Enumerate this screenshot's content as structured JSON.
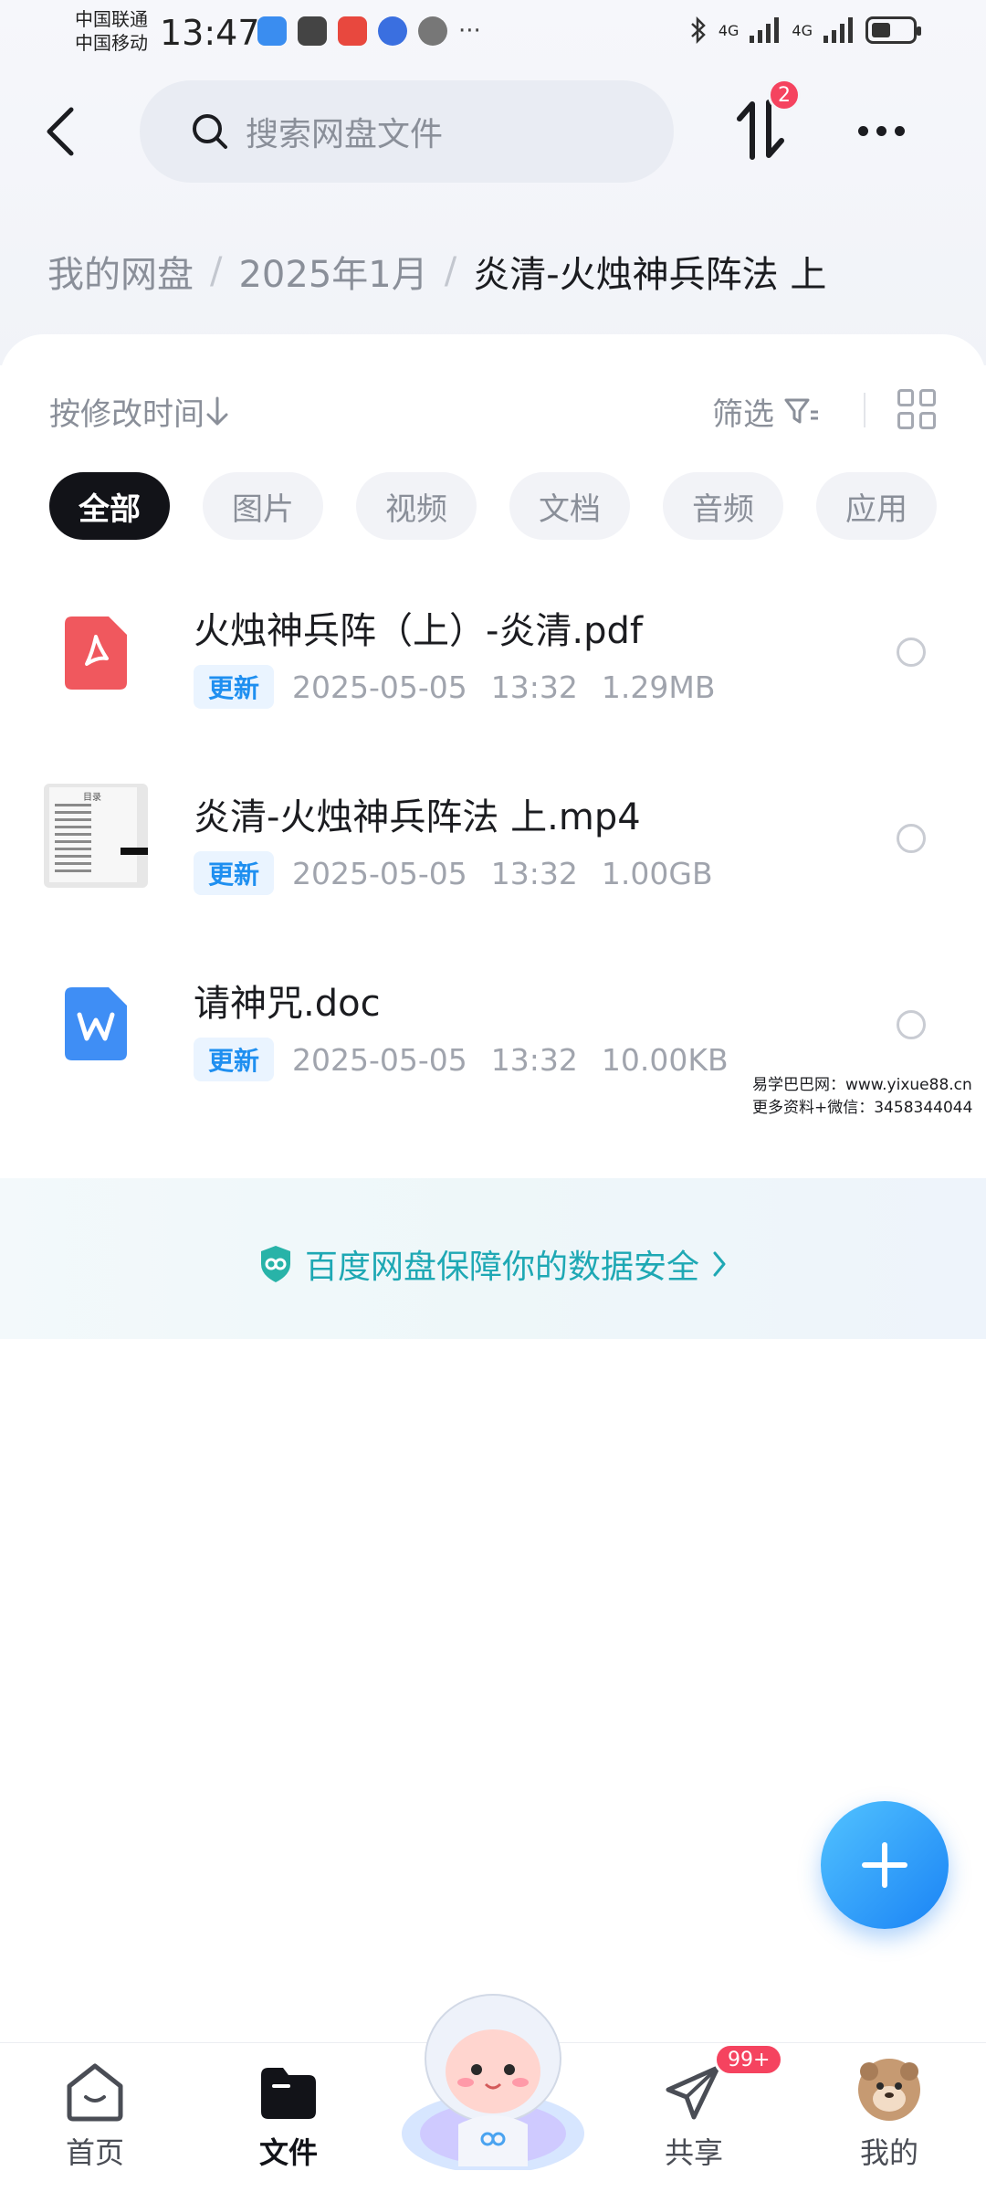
{
  "status_bar": {
    "carrier_1": "中国联通",
    "carrier_2": "中国移动",
    "time": "13:47",
    "network_1": "4G",
    "network_2": "4G"
  },
  "header": {
    "search_placeholder": "搜索网盘文件",
    "transfer_badge": "2"
  },
  "breadcrumb": {
    "items": [
      "我的网盘",
      "2025年1月"
    ],
    "current": "炎清-火烛神兵阵法 上"
  },
  "toolbar": {
    "sort_label": "按修改时间",
    "filter_label": "筛选"
  },
  "chips": [
    {
      "label": "全部",
      "active": true
    },
    {
      "label": "图片",
      "active": false
    },
    {
      "label": "视频",
      "active": false
    },
    {
      "label": "文档",
      "active": false
    },
    {
      "label": "音频",
      "active": false
    },
    {
      "label": "应用",
      "active": false
    }
  ],
  "files": [
    {
      "name": "火烛神兵阵（上）-炎清.pdf",
      "tag": "更新",
      "date": "2025-05-05",
      "time": "13:32",
      "size": "1.29MB",
      "icon": "pdf-icon",
      "icon_color": "#f0585e"
    },
    {
      "name": "炎清-火烛神兵阵法 上.mp4",
      "tag": "更新",
      "date": "2025-05-05",
      "time": "13:32",
      "size": "1.00GB",
      "icon": "video-thumbnail"
    },
    {
      "name": "请神咒.doc",
      "tag": "更新",
      "date": "2025-05-05",
      "time": "13:32",
      "size": "10.00KB",
      "icon": "word-icon",
      "icon_color": "#3f8ef5"
    }
  ],
  "thumbnail": {
    "title": "目录"
  },
  "watermark": {
    "line_1": "易学巴巴网：www.yixue88.cn",
    "line_2": "更多资料+微信：3458344044"
  },
  "security_banner": {
    "text": "百度网盘保障你的数据安全"
  },
  "bottom_nav": {
    "items": [
      {
        "label": "首页",
        "active": false
      },
      {
        "label": "文件",
        "active": true
      },
      {
        "label": "共享",
        "active": false
      },
      {
        "label": "我的",
        "active": false
      }
    ],
    "share_badge": "99+"
  },
  "colors": {
    "accent": "#1f8ff0",
    "badge": "#f5435f",
    "security": "#1ea8b4"
  }
}
